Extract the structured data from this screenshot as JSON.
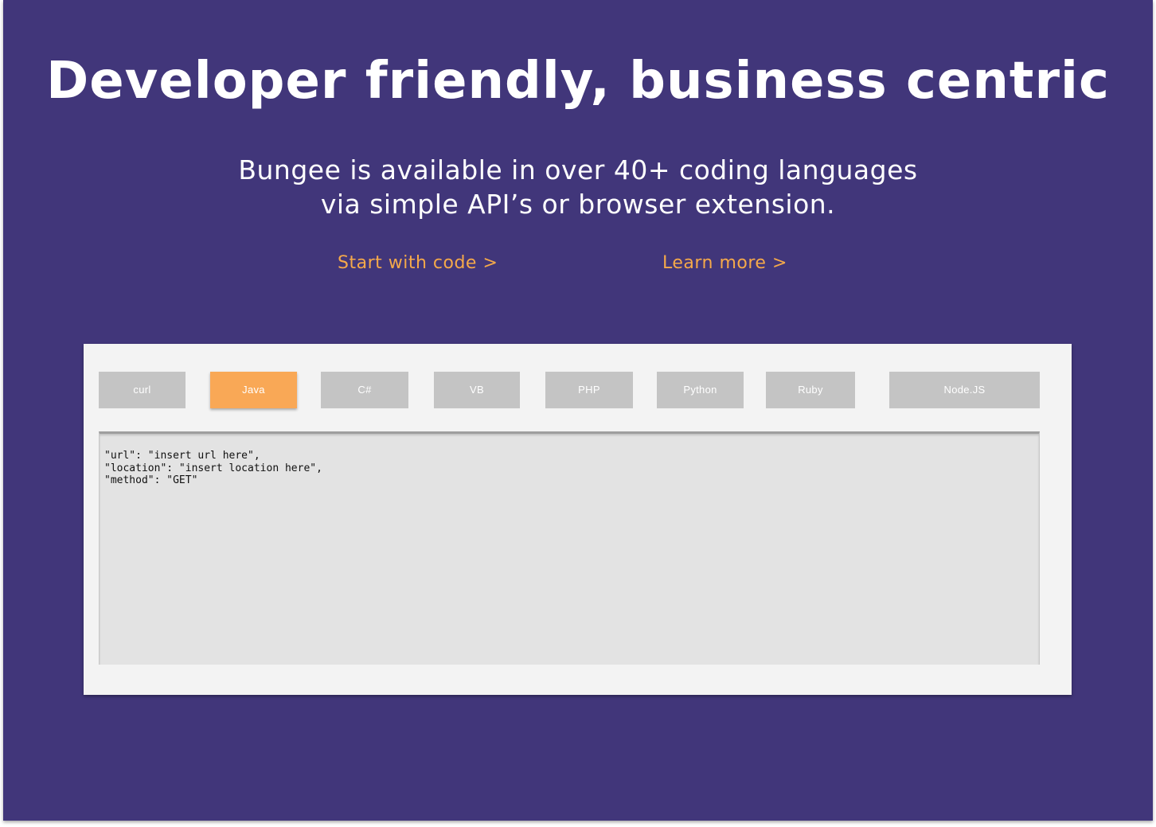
{
  "hero": {
    "headline": "Developer friendly, business centric",
    "subtitle_line1": "Bungee is available in over 40+ coding languages",
    "subtitle_line2": "via simple API’s or browser extension.",
    "start_link": "Start with code >",
    "learn_link": "Learn more >"
  },
  "tabs": [
    {
      "label": "curl",
      "active": false
    },
    {
      "label": "Java",
      "active": true
    },
    {
      "label": "C#",
      "active": false
    },
    {
      "label": "VB",
      "active": false
    },
    {
      "label": "PHP",
      "active": false
    },
    {
      "label": "Python",
      "active": false
    },
    {
      "label": "Ruby",
      "active": false
    },
    {
      "label": "Node.JS",
      "active": false
    }
  ],
  "code": {
    "lines": [
      "\"url\": \"insert url here\",",
      "\"location\": \"insert location here\",",
      "\"method\": \"GET\""
    ]
  },
  "colors": {
    "background": "#41367a",
    "accent": "#f5a94a",
    "tab_active": "#f9a856",
    "tab_inactive": "#c4c4c4",
    "panel": "#f3f3f3",
    "code_bg": "#e3e3e3"
  }
}
